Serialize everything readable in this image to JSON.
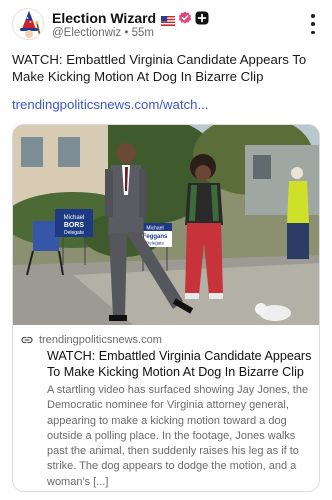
{
  "post": {
    "author": {
      "display_name": "Election Wizard",
      "handle": "@Electionwiz",
      "separator": "•",
      "time": "55m",
      "badges": [
        "flag-icon",
        "verified-icon",
        "plus-icon"
      ],
      "avatar": "wizard-avatar"
    },
    "text": "WATCH: Embattled Virginia Candidate Appears To Make Kicking Motion At Dog In Bizarre Clip",
    "link_text": "trendingpoliticsnews.com/watch..."
  },
  "card": {
    "domain": "trendingpoliticsnews.com",
    "title": "WATCH: Embattled Virginia Candidate Appears To Make Kicking Motion At Dog In Bizarre Clip",
    "description": "A startling video has surfaced showing Jay Jones, the Democratic nominee for Virginia attorney general, appearing to make a kicking motion toward a dog outside a polling place. In the footage, Jones walks past the animal, then suddenly raises his leg as if to strike. The dog appears to dodge the motion, and a woman's [...]",
    "image": {
      "sign_lines": [
        "Michael",
        "BORS",
        "Delegate"
      ],
      "sign2_lines": [
        "Michael",
        "Feggans",
        "Delegate"
      ]
    }
  },
  "colors": {
    "link": "#3d57c9",
    "verified": "#e0457b",
    "muted": "#6b6b6b"
  }
}
